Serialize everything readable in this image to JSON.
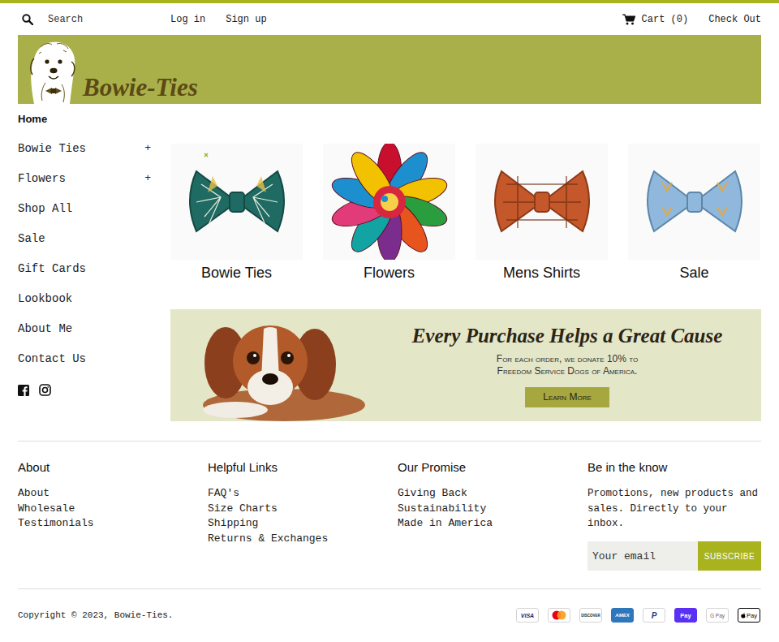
{
  "header": {
    "search": {
      "placeholder": "Search"
    },
    "login": "Log in",
    "signup": "Sign up",
    "cart": "Cart (0)",
    "checkout": "Check Out"
  },
  "logo": {
    "text": "Bowie-Ties"
  },
  "sidebar": {
    "items": [
      {
        "label": "Home",
        "selected": true
      },
      {
        "label": "Bowie Ties",
        "toggle": "+",
        "selected": false
      },
      {
        "label": "Flowers",
        "toggle": "+",
        "selected": false
      },
      {
        "label": "Shop All",
        "selected": false
      },
      {
        "label": "Sale",
        "selected": false
      },
      {
        "label": "Gift Cards",
        "selected": false
      },
      {
        "label": "Lookbook",
        "selected": false
      },
      {
        "label": "About Me",
        "selected": false
      },
      {
        "label": "Contact Us",
        "selected": false
      }
    ]
  },
  "collections": [
    {
      "label": "Bowie Ties"
    },
    {
      "label": "Flowers"
    },
    {
      "label": "Mens Shirts"
    },
    {
      "label": "Sale"
    }
  ],
  "promo": {
    "title": "Every Purchase Helps a Great Cause",
    "lines": [
      "For each order, we donate 10% to",
      "Freedom Service Dogs of America."
    ],
    "button": "Learn More"
  },
  "footer": {
    "columns": [
      {
        "title": "About",
        "links": [
          "About",
          "Wholesale",
          "Testimonials"
        ]
      },
      {
        "title": "Helpful Links",
        "links": [
          "FAQ's",
          "Size Charts",
          "Shipping",
          "Returns & Exchanges"
        ]
      },
      {
        "title": "Our Promise",
        "links": [
          "Giving Back",
          "Sustainability",
          "Made in America"
        ]
      }
    ],
    "newsletter": {
      "title": "Be in the know",
      "text": "Promotions, new products and sales. Directly to your inbox.",
      "placeholder": "Your email",
      "button": "SUBSCRIBE"
    }
  },
  "copyright": "Copyright © 2023, Bowie-Ties.",
  "payments": [
    {
      "kind": "visa",
      "label": "VISA"
    },
    {
      "kind": "mastercard"
    },
    {
      "kind": "discover",
      "label": "DISCOVER"
    },
    {
      "kind": "amex",
      "label": "AMEX"
    },
    {
      "kind": "paypal",
      "label": "P"
    },
    {
      "kind": "shoppay",
      "label": "Pay"
    },
    {
      "kind": "gpay",
      "label": "G Pay"
    },
    {
      "kind": "applepay",
      "label": "Pay"
    }
  ]
}
